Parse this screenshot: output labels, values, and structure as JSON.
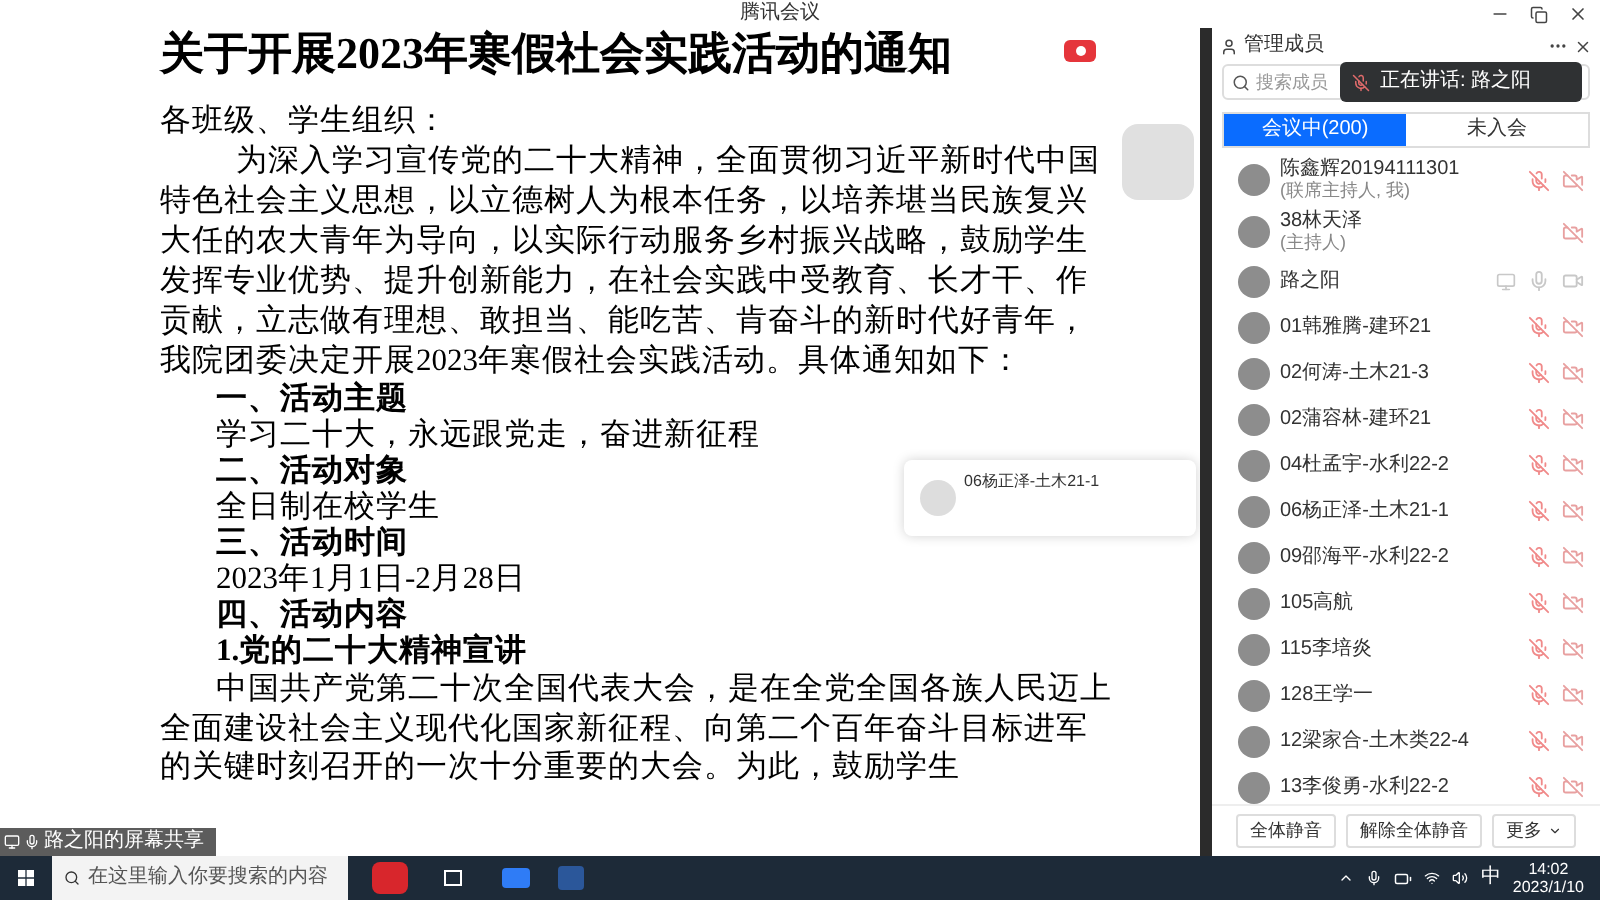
{
  "window": {
    "title": "腾讯会议"
  },
  "document": {
    "title": "关于开展2023年寒假社会实践活动的通知",
    "greeting": "各班级、学生组织：",
    "intro": "为深入学习宣传党的二十大精神，全面贯彻习近平新时代中国特色社会主义思想，以立德树人为根本任务，以培养堪当民族复兴大任的农大青年为导向，以实际行动服务乡村振兴战略，鼓励学生发挥专业优势、提升创新能力，在社会实践中受教育、长才干、作贡献，立志做有理想、敢担当、能吃苦、肯奋斗的新时代好青年，我院团委决定开展2023年寒假社会实践活动。具体通知如下：",
    "sections": [
      {
        "kind": "heading",
        "text": "一、活动主题"
      },
      {
        "kind": "body",
        "text": "学习二十大，永远跟党走，奋进新征程"
      },
      {
        "kind": "heading",
        "text": "二、活动对象"
      },
      {
        "kind": "body",
        "text": "全日制在校学生"
      },
      {
        "kind": "heading",
        "text": "三、活动时间"
      },
      {
        "kind": "body",
        "text": "2023年1月1日-2月28日"
      },
      {
        "kind": "heading",
        "text": "四、活动内容"
      },
      {
        "kind": "subheading",
        "text": "1.党的二十大精神宣讲"
      },
      {
        "kind": "paragraph",
        "text": "中国共产党第二十次全国代表大会，是在全党全国各族人民迈上全面建设社会主义现代化国家新征程、向第二个百年奋斗目标进军的关键时刻召开的一次十分重要的大会。为此，鼓励学生"
      }
    ]
  },
  "screen_share_label": "路之阳的屏幕共享",
  "speaking_popup": {
    "name": "06杨正泽-土木21-1"
  },
  "panel": {
    "title": "管理成员",
    "search": {
      "placeholder": "搜索成员"
    },
    "speaking_toast": "正在讲话: 路之阳",
    "tabs": [
      {
        "label": "会议中(200)",
        "selected": true
      },
      {
        "label": "未入会",
        "selected": false
      }
    ],
    "members": [
      {
        "name": "陈鑫辉20194111301",
        "role": "(联席主持人, 我)",
        "mic_muted": true,
        "video_off": true,
        "sharing": false
      },
      {
        "name": "38林天泽",
        "role": "(主持人)",
        "video_off": true,
        "sharing": false
      },
      {
        "name": "路之阳",
        "mic_muted": false,
        "video_off": false,
        "sharing": true
      },
      {
        "name": "01韩雅腾-建环21",
        "mic_muted": true,
        "video_off": true,
        "sharing": false
      },
      {
        "name": "02何涛-土木21-3",
        "mic_muted": true,
        "video_off": true,
        "sharing": false
      },
      {
        "name": "02蒲容林-建环21",
        "mic_muted": true,
        "video_off": true,
        "sharing": false
      },
      {
        "name": "04杜孟宇-水利22-2",
        "mic_muted": true,
        "video_off": true,
        "sharing": false
      },
      {
        "name": "06杨正泽-土木21-1",
        "mic_muted": true,
        "video_off": true,
        "sharing": false
      },
      {
        "name": "09邵海平-水利22-2",
        "mic_muted": true,
        "video_off": true,
        "sharing": false
      },
      {
        "name": "105高航",
        "mic_muted": true,
        "video_off": true,
        "sharing": false
      },
      {
        "name": "115李培炎",
        "mic_muted": true,
        "video_off": true,
        "sharing": false
      },
      {
        "name": "128王学一",
        "mic_muted": true,
        "video_off": true,
        "sharing": false
      },
      {
        "name": "12梁家合-土木类22-4",
        "mic_muted": true,
        "video_off": true,
        "sharing": false
      },
      {
        "name": "13李俊勇-水利22-2",
        "mic_muted": true,
        "video_off": true,
        "sharing": false
      }
    ],
    "buttons": [
      "全体静音",
      "解除全体静音",
      "更多"
    ]
  },
  "taskbar": {
    "search_placeholder": "在这里输入你要搜索的内容",
    "ime": "中",
    "time": "14:02",
    "date": "2023/1/10"
  }
}
